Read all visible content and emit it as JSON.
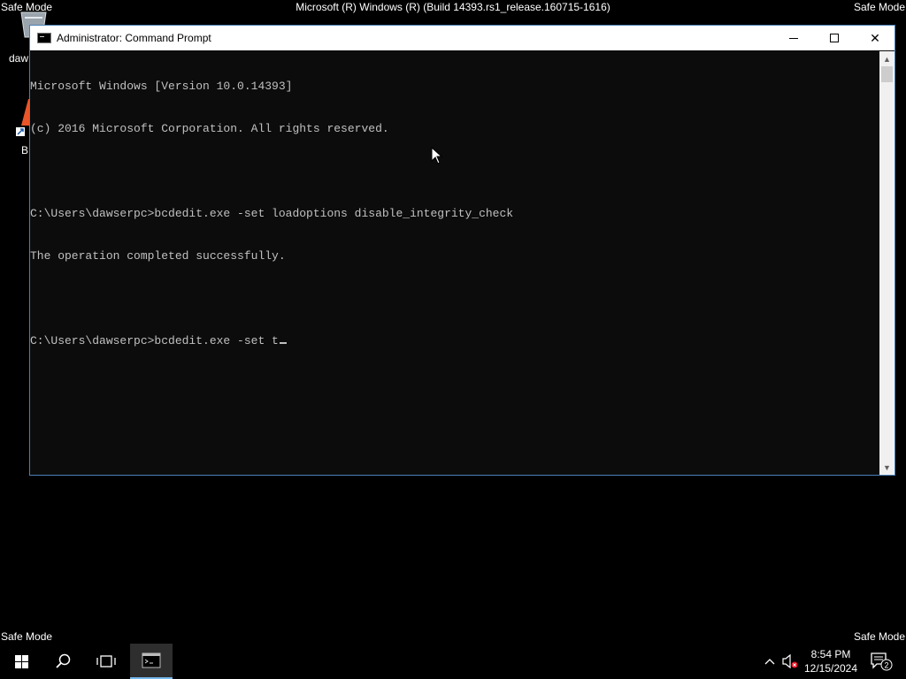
{
  "desktop": {
    "safe_mode_label": "Safe Mode",
    "build_text": "Microsoft (R) Windows (R) (Build 14393.rs1_release.160715-1616)",
    "icons": [
      {
        "icon": "recycle-bin-icon",
        "label": "daw"
      },
      {
        "icon": "app-shortcut-icon",
        "label": "B"
      }
    ]
  },
  "window": {
    "title": "Administrator: Command Prompt",
    "icon": "cmd-icon",
    "controls": {
      "minimize": "minimize-icon",
      "maximize": "maximize-icon",
      "close": "✕"
    },
    "console_lines": [
      "Microsoft Windows [Version 10.0.14393]",
      "(c) 2016 Microsoft Corporation. All rights reserved.",
      "",
      "C:\\Users\\dawserpc>bcdedit.exe -set loadoptions disable_integrity_check",
      "The operation completed successfully.",
      "",
      "C:\\Users\\dawserpc>bcdedit.exe -set t"
    ],
    "scroll": {
      "up": "▲",
      "down": "▼"
    }
  },
  "taskbar": {
    "start_icon": "windows-start-icon",
    "search_icon": "search-icon",
    "taskview_icon": "task-view-icon",
    "running_app_icon": "cmd-icon",
    "tray_up": "^",
    "volume_icon": "volume-muted-icon",
    "time": "8:54 PM",
    "date": "12/15/2024",
    "notification_count": "2"
  },
  "colors": {
    "console_bg": "#0c0c0c",
    "console_text": "#c0c0c0",
    "window_border": "#4a7fb5",
    "taskbar_accent": "#76b9ed"
  }
}
